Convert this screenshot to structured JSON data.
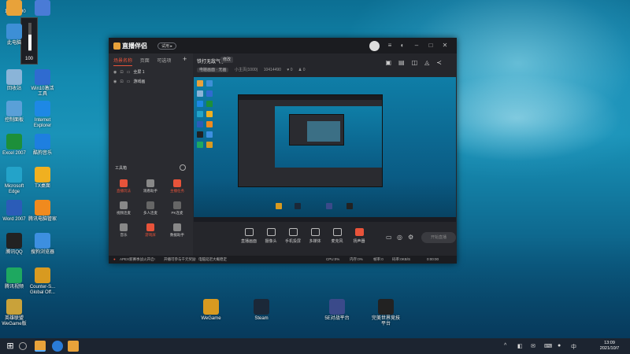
{
  "desktop": {
    "top_left_label": "10414490",
    "volume": {
      "value": "100",
      "level_fraction": 0.55
    },
    "icons_left": [
      {
        "label": "",
        "color": "#e8a23a"
      },
      {
        "label": "",
        "color": "#4a7bd6"
      },
      {
        "label": "此电脑",
        "color": "#3d8fd6"
      },
      {
        "label": "回收站",
        "color": "#8ab4d8"
      },
      {
        "label": "Win10激活\n工具",
        "color": "#2f6bd0"
      },
      {
        "label": "控制面板",
        "color": "#5aa0d8"
      },
      {
        "label": "Internet\nExplorer",
        "color": "#1e88e5"
      },
      {
        "label": "Excel 2007",
        "color": "#1d8f3a"
      },
      {
        "label": "酷狗音乐",
        "color": "#1e7fe0"
      },
      {
        "label": "Microsoft\nEdge",
        "color": "#23a3c9"
      },
      {
        "label": "TX桌面",
        "color": "#f0b020"
      },
      {
        "label": "Word 2007",
        "color": "#2b5cb8"
      },
      {
        "label": "腾讯电脑管家",
        "color": "#f08a1e"
      },
      {
        "label": "腾讯QQ",
        "color": "#222222"
      },
      {
        "label": "搜狗浏览器",
        "color": "#3d8fe0"
      },
      {
        "label": "腾讯视频",
        "color": "#1ea860"
      },
      {
        "label": "Counter-S...\nGlobal Off...",
        "color": "#d89a20"
      },
      {
        "label": "英雄联盟\nWeGame版",
        "color": "#c9a23a"
      }
    ],
    "icons_bottom": [
      {
        "label": "WeGame",
        "color": "#d89a20"
      },
      {
        "label": "Steam",
        "color": "#1b2838"
      },
      {
        "label": "5E对战平台",
        "color": "#3a4a8a"
      },
      {
        "label": "完美世界竞技\n平台",
        "color": "#222222"
      }
    ]
  },
  "app": {
    "name": "直播伴侣",
    "version_badge": "试用 ▸",
    "tabs": [
      "场景名称",
      "页面",
      "可选项"
    ],
    "add_tab": "+",
    "sources": [
      {
        "label": "全屏 1"
      },
      {
        "label": "游戏画"
      }
    ],
    "tools_header": "工具箱",
    "tools": [
      {
        "label": "直播玩法",
        "color": "#e8533a",
        "red": true
      },
      {
        "label": "观看助手",
        "color": "#888888",
        "red": false
      },
      {
        "label": "主播任务",
        "color": "#e8533a",
        "red": true
      },
      {
        "label": "视频连麦",
        "color": "#888888",
        "red": false
      },
      {
        "label": "多人连麦",
        "color": "#666666",
        "red": false
      },
      {
        "label": "PK连麦",
        "color": "#666666",
        "red": false
      },
      {
        "label": "音乐",
        "color": "#888888",
        "red": false
      },
      {
        "label": "游戏屏",
        "color": "#e8533a",
        "red": true
      },
      {
        "label": "数据助手",
        "color": "#888888",
        "red": false
      }
    ],
    "preview_title": "铁打无敌气了",
    "preview_pill": "修改",
    "preview_sub": [
      "电脑画面 · 无画",
      "小主页(1000)",
      "10414490",
      "0",
      "0"
    ],
    "controls": [
      {
        "label": "直播画面",
        "red": false
      },
      {
        "label": "摄像头",
        "red": false
      },
      {
        "label": "手机投屏",
        "red": false
      },
      {
        "label": "多媒体",
        "red": false
      },
      {
        "label": "麦克风",
        "red": false
      },
      {
        "label": "扬声器",
        "red": true
      }
    ],
    "start_button": "开始直播",
    "status": {
      "left": "APEX新赛季战火开启!",
      "mid": "开播可参与千元奖励",
      "mid2": "电脑延迟大概稳定",
      "right": [
        "CPU:0%",
        "内存:0%",
        "帧率:0",
        "码率:0KB/S",
        "0:00:00"
      ]
    }
  },
  "taskbar": {
    "tray_icons": [
      "^",
      "◧",
      "✉",
      "⌨",
      "●",
      "中"
    ],
    "time": "13:09",
    "date": "2021/10/7"
  }
}
